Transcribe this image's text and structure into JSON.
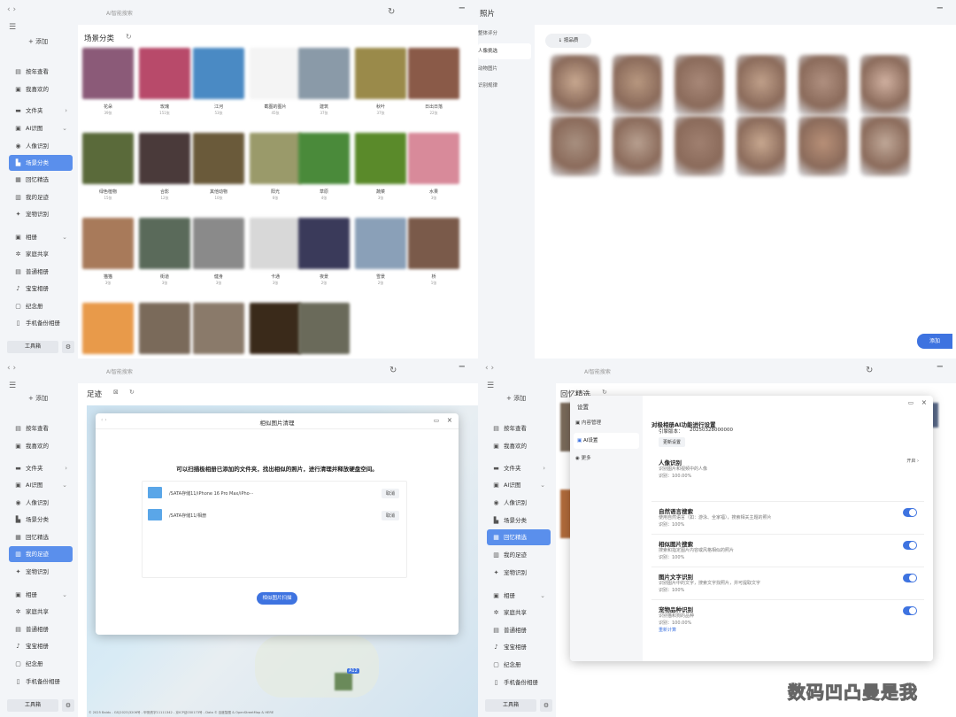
{
  "app": {
    "title": "AI智能搜索",
    "nav": "‹  ›",
    "refresh_icon": "↻",
    "min_icon": "−",
    "menu_icon": "☰"
  },
  "sidebar": {
    "add_label": "+ 添加",
    "items": {
      "year": "按年查看",
      "fav": "我喜欢的",
      "folder": "文件夹",
      "ai": "AI识图",
      "people": "人像识别",
      "scene": "场景分类",
      "memory": "回忆精选",
      "footprint": "我的足迹",
      "pet": "宠物识别",
      "album": "相册",
      "family": "家庭共享",
      "normal": "普通相册",
      "baby": "宝宝相册",
      "souvenir": "纪念册",
      "phone": "手机备份相册"
    },
    "toolbox": "工具箱",
    "gear_icon": "⚙"
  },
  "q1": {
    "title": "场景分类",
    "rows": [
      [
        {
          "label": "花朵",
          "count": "39张",
          "c": "#8b5a78"
        },
        {
          "label": "玫瑰",
          "count": "151张",
          "c": "#b84a6a"
        },
        {
          "label": "江河",
          "count": "53张",
          "c": "#4a8ac4"
        },
        {
          "label": "截图的图片",
          "count": "45张",
          "c": "#f4f4f4"
        },
        {
          "label": "建筑",
          "count": "37张",
          "c": "#8a9aa8"
        },
        {
          "label": "秋叶",
          "count": "37张",
          "c": "#9a8a4a"
        },
        {
          "label": "日出日落",
          "count": "22张",
          "c": "#8a5a48"
        }
      ],
      [
        {
          "label": "绿色植物",
          "count": "15张",
          "c": "#5a6a3a"
        },
        {
          "label": "合影",
          "count": "12张",
          "c": "#4a3a3a"
        },
        {
          "label": "其他动物",
          "count": "10张",
          "c": "#6a5a3a"
        },
        {
          "label": "阳光",
          "count": "6张",
          "c": "#9a9a6a"
        },
        {
          "label": "草原",
          "count": "4张",
          "c": "#4a8a3a"
        },
        {
          "label": "蔬菜",
          "count": "3张",
          "c": "#5a8a2a"
        },
        {
          "label": "水果",
          "count": "3张",
          "c": "#d88a9a"
        }
      ],
      [
        {
          "label": "猫猫",
          "count": "3张",
          "c": "#a87a5a"
        },
        {
          "label": "街道",
          "count": "3张",
          "c": "#5a6a5a"
        },
        {
          "label": "健身",
          "count": "3张",
          "c": "#8a8a8a"
        },
        {
          "label": "卡通",
          "count": "3张",
          "c": "#d8d8d8"
        },
        {
          "label": "夜景",
          "count": "2张",
          "c": "#3a3a5a"
        },
        {
          "label": "雪景",
          "count": "2张",
          "c": "#8aa0b8"
        },
        {
          "label": "桥",
          "count": "1张",
          "c": "#7a5a4a"
        }
      ],
      [
        {
          "label": "",
          "count": "",
          "c": "#e89a4a"
        },
        {
          "label": "",
          "count": "",
          "c": "#7a6a5a"
        },
        {
          "label": "",
          "count": "",
          "c": "#8a7a6a"
        },
        {
          "label": "",
          "count": "",
          "c": "#3a2a1a"
        },
        {
          "label": "",
          "count": "",
          "c": "#6a6a5a"
        }
      ]
    ]
  },
  "q2": {
    "title": "照片",
    "menu": [
      "整体评分",
      "人像挑选",
      "动物图片",
      "识别规律"
    ],
    "sort_label": "↓ 按品质",
    "add_label": "添加",
    "faces": [
      "#c8a890",
      "#b89880",
      "#a88878",
      "#c0a08a",
      "#b09080",
      "#d0b0a0",
      "#a89080",
      "#b8a090",
      "#a08070",
      "#c8a890",
      "#b89078",
      "#c0a898"
    ]
  },
  "q3": {
    "title": "足迹",
    "modal_title": "相似图片清理",
    "desc": "可以扫描极相册已添加的文件夹，找出相似的照片，进行清理并释放硬盘空间。",
    "folders": [
      "/SATA存储11/iPhone 16 Pro Max/iPho···",
      "/SATA存储11/相册"
    ],
    "cancel": "取消",
    "scan_btn": "相似图片扫描",
    "map_label": "A12",
    "footer": "© 2025 Baidu - GS(2023)3206号 - 甲测资字11111342 - 京ICP证030173号 - Data © 百度智图 & OpenStreetMap & HERE"
  },
  "q4": {
    "title": "回忆精选",
    "dlg_title": "设置",
    "menu": [
      "内容管理",
      "AI设置",
      "更多"
    ],
    "heading": "对极相册AI功能进行设置",
    "engine_label": "引擎版本：",
    "engine_version": "20250328000000",
    "update_btn": "更新设置",
    "sections": [
      {
        "title": "人像识别",
        "desc": "识别图片和视频中的人像",
        "rate": "识别：100.00%",
        "action": "开启 ›"
      },
      {
        "title": "自然语言搜索",
        "desc": "使用自然语言（如：游泳、全家福），搜索相关主题的照片",
        "rate": "识别：100%"
      },
      {
        "title": "相似图片搜索",
        "desc": "搜索和指定图片内容或风格相似的照片",
        "rate": "识别：100%"
      },
      {
        "title": "图片文字识别",
        "desc": "识别图片中的文字，搜索文字找照片，并可提取文字",
        "rate": "识别：100%"
      },
      {
        "title": "宠物品种识别",
        "desc": "识别猫和狗的品种",
        "rate": "识别：100.00%",
        "link": "重新计算"
      }
    ]
  },
  "watermark": "数码凹凸曼是我"
}
